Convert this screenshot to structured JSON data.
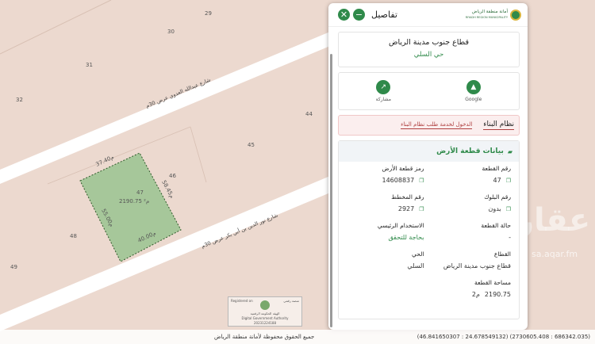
{
  "map": {
    "numbers": [
      "29",
      "30",
      "31",
      "32",
      "44",
      "45",
      "46",
      "48",
      "49"
    ],
    "roads": {
      "upper": "شارع عبدالله العدوي عرض 30م",
      "lower": "شارع نور الدين بن أبي بكر عرض 30م"
    },
    "parcel": {
      "number": "47",
      "area": "2190.75 م²",
      "dim_top": "37.40م",
      "dim_left": "55.00م",
      "dim_bottom": "40.00م",
      "dim_right": "58.45م"
    },
    "dga": {
      "registered": "Registered on",
      "platform_ar": "منصة رقمي",
      "name_ar": "الهيئة الحكومة الرقمية",
      "name_en": "Digital Government Authority",
      "code": "20231224188"
    }
  },
  "panel": {
    "title": "تفاصيل",
    "logo_ar": "أمانة منطقة الرياض",
    "logo_en": "RIYADH REGION MUNICIPALITY",
    "minimize_icon": "−",
    "close_icon": "✕",
    "place_title": "قطاع جنوب مدينة الرياض",
    "place_sub": "حي السلي",
    "actions": {
      "google": "Google",
      "share": "مشاركة"
    },
    "building_system": {
      "title": "نظام البناء",
      "link": "الدخول لخدمة طلب نظام البناء"
    },
    "land_data": {
      "title": "بيانات قطعة الأرض",
      "fields": {
        "parcel_no_label": "رقم القطعة",
        "parcel_no": "47",
        "parcel_code_label": "رمز قطعة الأرض",
        "parcel_code": "14608837",
        "block_label": "رقم البلوك",
        "block": "بدون",
        "plan_label": "رقم المخطط",
        "plan": "2927",
        "status_label": "حالة القطعة",
        "status": "-",
        "usage_label": "الاستخدام الرئيسي",
        "usage": "بحاجة للتحقق",
        "sector_label": "القطاع",
        "sector": "قطاع جنوب مدينة الرياض",
        "district_label": "الحي",
        "district": "السلي",
        "area_label": "مساحة القطعة",
        "area": "2190.75",
        "area_unit": "م2"
      }
    }
  },
  "footer": {
    "copyright": "جميع الحقوق محفوظة لأمانة منطقة الرياض",
    "coords": "(46.841650307 : 24.678549132) (2730605.408 : 686342.035)"
  },
  "watermark": {
    "brand": "عقار",
    "url": "sa.aqar.fm"
  },
  "colors": {
    "accent": "#2f8a4a",
    "parcel_fill": "#a6c79a",
    "map_bg": "#ecd9cf",
    "road": "#ffffff",
    "link_red": "#b04040"
  }
}
